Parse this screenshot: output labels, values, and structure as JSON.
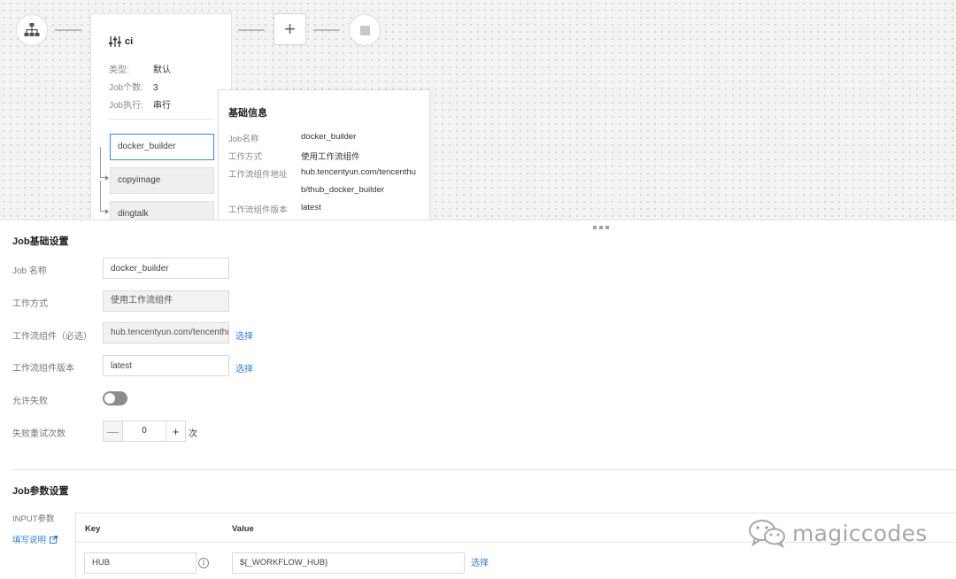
{
  "pipeline": {
    "stage": {
      "name": "ci",
      "type_label": "类型:",
      "type_value": "默认",
      "job_count_label": "Job个数:",
      "job_count_value": "3",
      "job_exec_label": "Job执行:",
      "job_exec_value": "串行",
      "jobs": [
        "docker_builder",
        "copyimage",
        "dingtalk"
      ]
    },
    "add_stage_symbol": "+"
  },
  "info_panel": {
    "title": "基础信息",
    "rows": [
      {
        "label": "Job名称",
        "value": "docker_builder"
      },
      {
        "label": "工作方式",
        "value": "使用工作流组件"
      },
      {
        "label": "工作流组件地址",
        "value": "hub.tencentyun.com/tencenthu"
      },
      {
        "label": "",
        "value": "b/thub_docker_builder"
      },
      {
        "label": "工作流组件版本",
        "value": "latest"
      }
    ]
  },
  "job_settings": {
    "title": "Job基础设置",
    "name_label": "Job 名称",
    "name_value": "docker_builder",
    "work_mode_label": "工作方式",
    "work_mode_value": "使用工作流组件",
    "component_label": "工作流组件（必选）",
    "component_value": "hub.tencentyun.com/tencenthub/thub_docker_builder",
    "component_select": "选择",
    "version_label": "工作流组件版本",
    "version_value": "latest",
    "version_select": "选择",
    "allow_fail_label": "允许失败",
    "allow_fail_on": false,
    "retry_label": "失败重试次数",
    "retry_minus": "—",
    "retry_value": "0",
    "retry_plus": "+",
    "retry_unit": "次"
  },
  "param_settings": {
    "title": "Job参数设置",
    "input_label": "INPUT参数",
    "help_link": "填写说明",
    "table": {
      "key_header": "Key",
      "value_header": "Value",
      "rows": [
        {
          "key": "HUB",
          "value": "${_WORKFLOW_HUB}",
          "select": "选择"
        }
      ]
    }
  },
  "watermark": {
    "text": "magiccodes"
  },
  "colors": {
    "accent": "#2f7fd8",
    "active_border": "#2f8be2",
    "toggle_off": "#8b8b8b",
    "canvas_bg": "#f3f3f3"
  },
  "icons": {
    "stage_start": "org-tree-icon",
    "stage_settings": "sliders-icon",
    "stop": "stop-icon",
    "external_link": "external-link-icon",
    "info": "info-icon",
    "watermark": "wechat-icon"
  }
}
